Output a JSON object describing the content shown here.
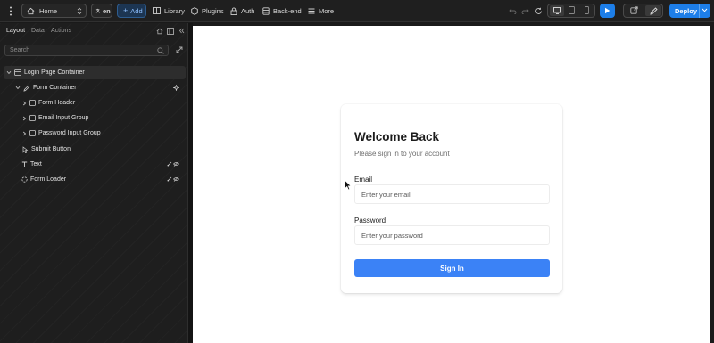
{
  "topbar": {
    "page_select": "Home",
    "language": "en",
    "add_label": "Add",
    "nav": [
      {
        "label": "Library",
        "icon": "library-icon"
      },
      {
        "label": "Plugins",
        "icon": "plugins-icon"
      },
      {
        "label": "Auth",
        "icon": "lock-icon"
      },
      {
        "label": "Back-end",
        "icon": "database-icon"
      },
      {
        "label": "More",
        "icon": "menu-icon"
      }
    ],
    "deploy_label": "Deploy"
  },
  "panel": {
    "tabs": [
      "Layout",
      "Data",
      "Actions"
    ],
    "search_placeholder": "Search",
    "tree": [
      {
        "label": "Login Page Container"
      },
      {
        "label": "Form Container"
      },
      {
        "label": "Form Header"
      },
      {
        "label": "Email Input Group"
      },
      {
        "label": "Password Input Group"
      },
      {
        "label": "Submit Button"
      },
      {
        "label": "Text"
      },
      {
        "label": "Form Loader"
      }
    ]
  },
  "form": {
    "title": "Welcome Back",
    "subtitle": "Please sign in to your account",
    "email_label": "Email",
    "email_placeholder": "Enter your email",
    "password_label": "Password",
    "password_placeholder": "Enter your password",
    "submit_label": "Sign In"
  },
  "colors": {
    "accent": "#1d7ee8",
    "submit_button": "#3b82f6",
    "panel_bg": "#1e1e1e",
    "canvas_bg": "#ffffff"
  }
}
